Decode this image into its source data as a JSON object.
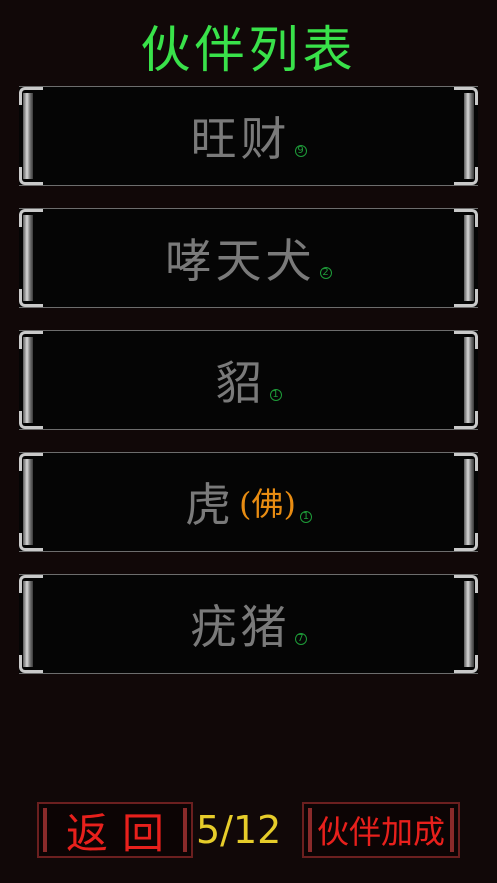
{
  "title": "伙伴列表",
  "companions": [
    {
      "name": "旺财",
      "tag": "",
      "level": "9"
    },
    {
      "name": "哮天犬",
      "tag": "",
      "level": "2"
    },
    {
      "name": "貂",
      "tag": "",
      "level": "1"
    },
    {
      "name": "虎",
      "tag": "(佛)",
      "level": "1"
    },
    {
      "name": "疣猪",
      "tag": "",
      "level": "7"
    }
  ],
  "footer": {
    "back_label": "返回",
    "count": "5/12",
    "bonus_label": "伙伴加成"
  },
  "colors": {
    "title": "#39e24a",
    "name": "#7a7a7a",
    "tag": "#e88c12",
    "button_text": "#e8201c",
    "count": "#e6cc2a"
  }
}
